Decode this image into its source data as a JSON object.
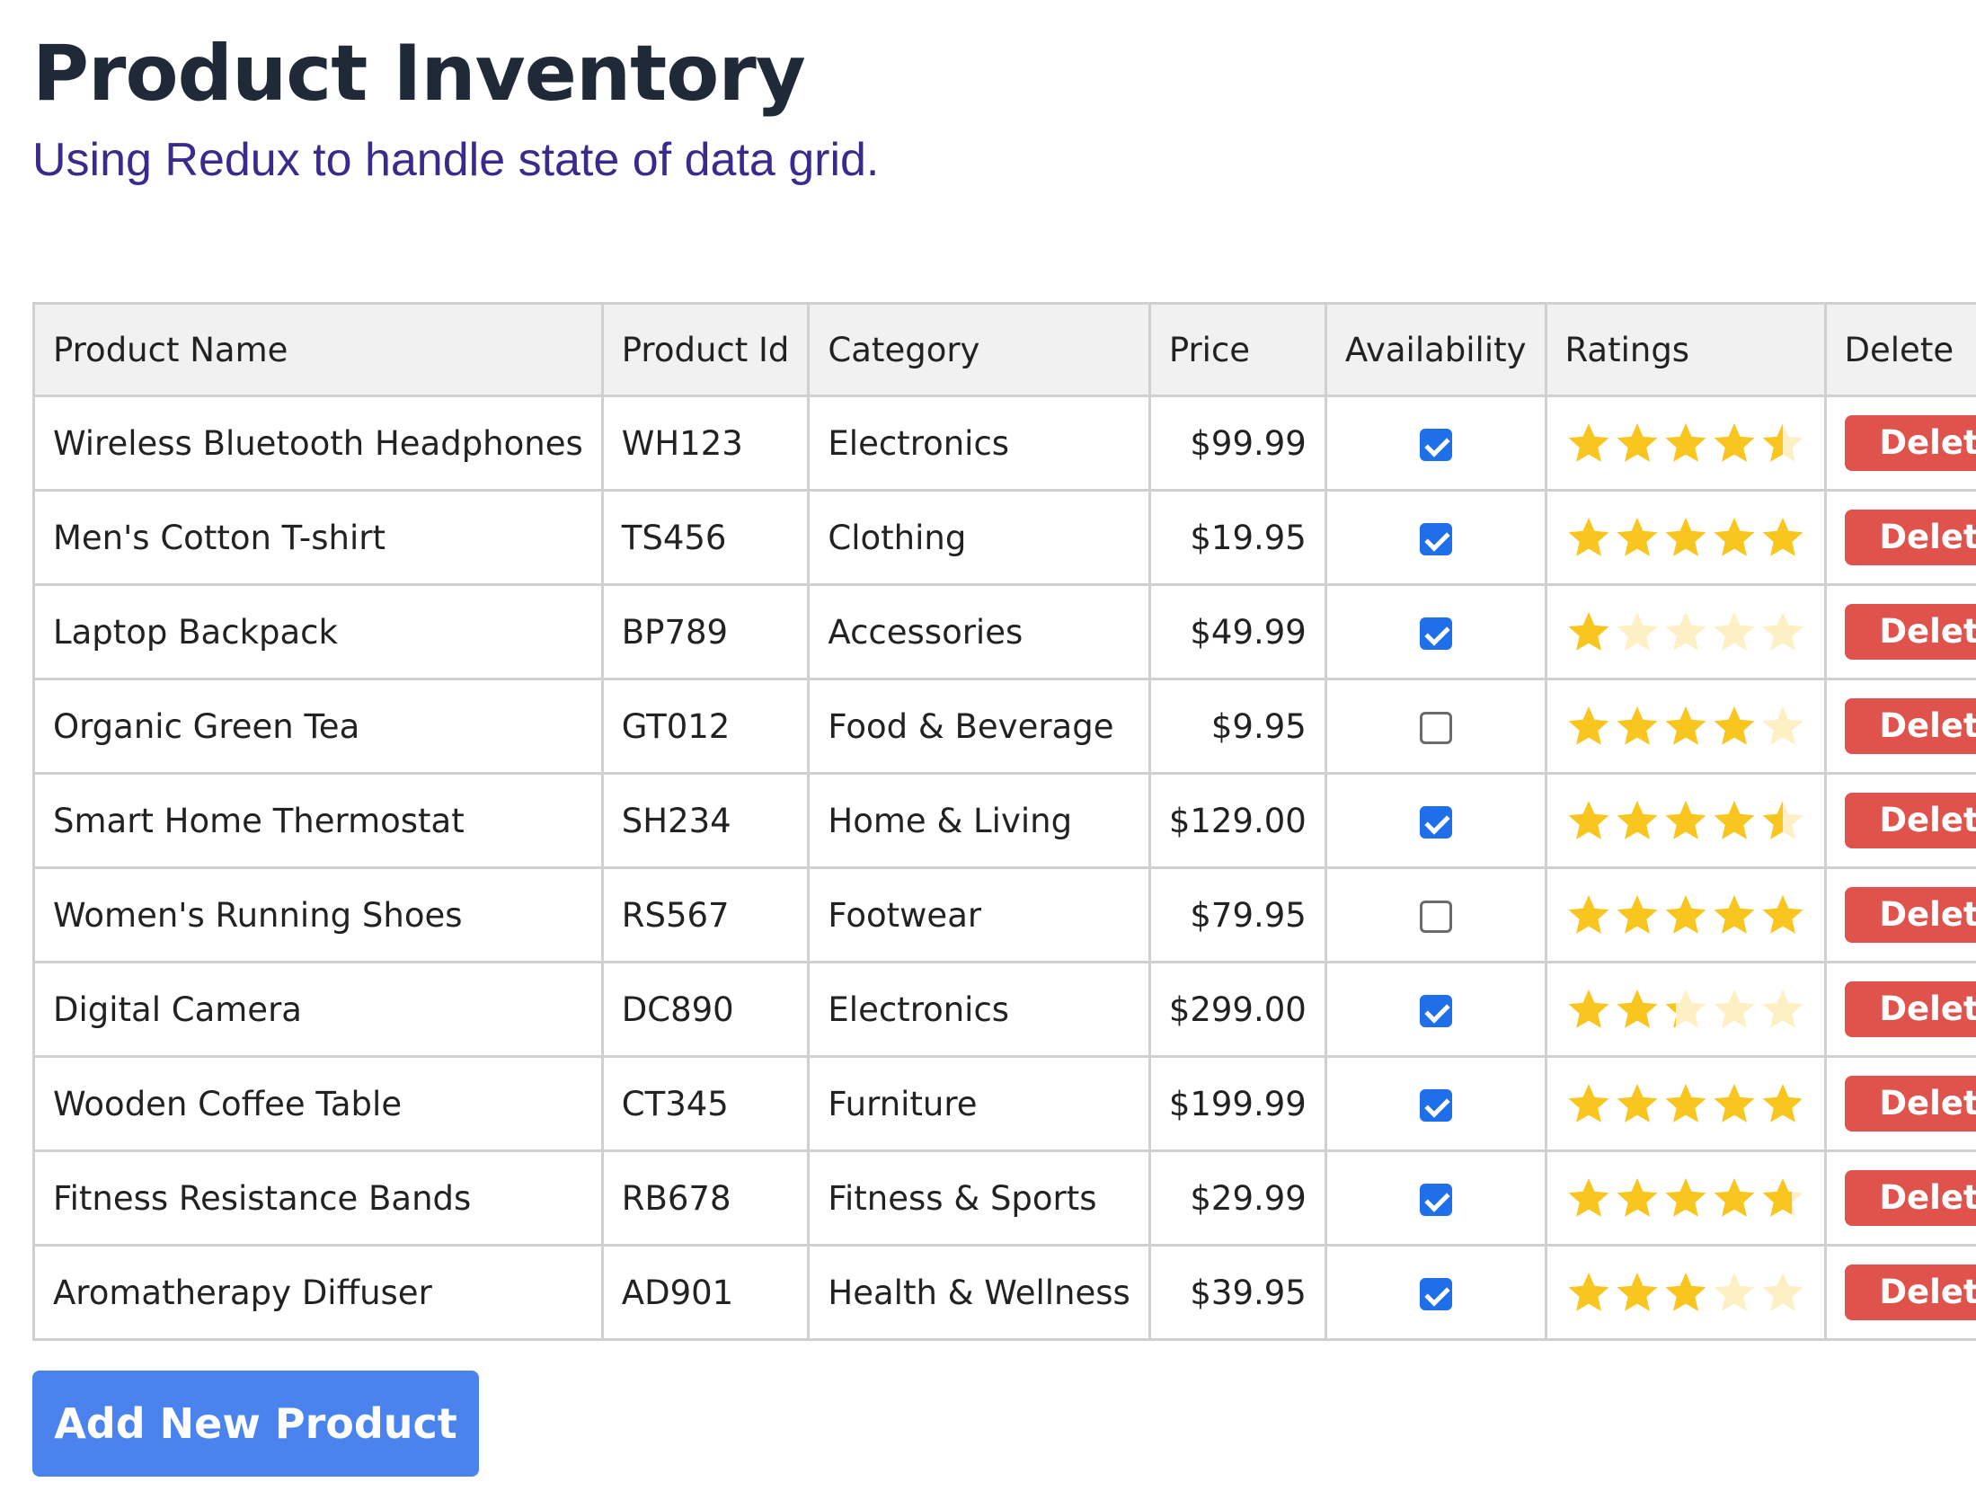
{
  "header": {
    "title": "Product Inventory",
    "subtitle": "Using Redux to handle state of data grid."
  },
  "table": {
    "columns": [
      "Product Name",
      "Product Id",
      "Category",
      "Price",
      "Availability",
      "Ratings",
      "Delete"
    ],
    "delete_label": "Delete",
    "rows": [
      {
        "name": "Wireless Bluetooth Headphones",
        "id": "WH123",
        "category": "Electronics",
        "price": "$99.99",
        "available": true,
        "rating": 4.5
      },
      {
        "name": "Men's Cotton T-shirt",
        "id": "TS456",
        "category": "Clothing",
        "price": "$19.95",
        "available": true,
        "rating": 5
      },
      {
        "name": "Laptop Backpack",
        "id": "BP789",
        "category": "Accessories",
        "price": "$49.99",
        "available": true,
        "rating": 1
      },
      {
        "name": "Organic Green Tea",
        "id": "GT012",
        "category": "Food & Beverage",
        "price": "$9.95",
        "available": false,
        "rating": 4
      },
      {
        "name": "Smart Home Thermostat",
        "id": "SH234",
        "category": "Home & Living",
        "price": "$129.00",
        "available": true,
        "rating": 4.5
      },
      {
        "name": "Women's Running Shoes",
        "id": "RS567",
        "category": "Footwear",
        "price": "$79.95",
        "available": false,
        "rating": 5
      },
      {
        "name": "Digital Camera",
        "id": "DC890",
        "category": "Electronics",
        "price": "$299.00",
        "available": true,
        "rating": 2.3
      },
      {
        "name": "Wooden Coffee Table",
        "id": "CT345",
        "category": "Furniture",
        "price": "$199.99",
        "available": true,
        "rating": 4.9
      },
      {
        "name": "Fitness Resistance Bands",
        "id": "RB678",
        "category": "Fitness & Sports",
        "price": "$29.99",
        "available": true,
        "rating": 4.7
      },
      {
        "name": "Aromatherapy Diffuser",
        "id": "AD901",
        "category": "Health & Wellness",
        "price": "$39.95",
        "available": true,
        "rating": 3
      }
    ]
  },
  "actions": {
    "add_label": "Add New Product"
  },
  "colors": {
    "star_filled": "#f8c61e",
    "star_empty": "#fdf0c4",
    "delete_button": "#e0524c",
    "add_button": "#4a83ee",
    "checkbox_checked": "#1f6feb"
  },
  "icons": {
    "rating": "star-icon",
    "available": "checkbox-checked-icon",
    "unavailable": "checkbox-empty-icon"
  }
}
